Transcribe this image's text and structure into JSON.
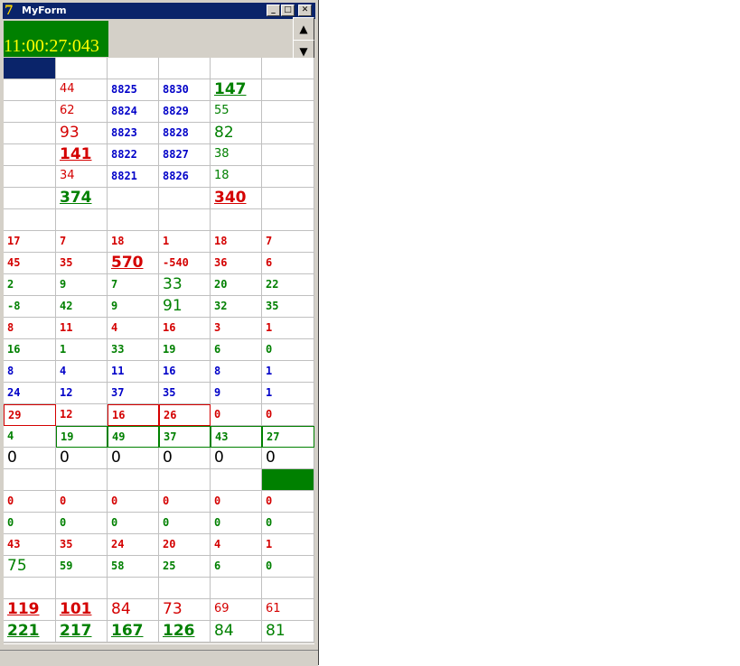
{
  "window": {
    "title": "MyForm",
    "icon": "delphi-app-icon",
    "minimize_label": "_",
    "maximize_label": "□",
    "close_label": "✕"
  },
  "clock": "11:00:27:043",
  "scroll_up_label": "▲",
  "scroll_down_label": "▼",
  "rows": [
    [
      {
        "t": "",
        "c": "fill-navy"
      },
      {
        "t": ""
      },
      {
        "t": ""
      },
      {
        "t": ""
      },
      {
        "t": ""
      },
      {
        "t": ""
      }
    ],
    [
      {
        "t": ""
      },
      {
        "t": "44",
        "c": "r m"
      },
      {
        "t": "8825",
        "c": "b s"
      },
      {
        "t": "8830",
        "c": "b s"
      },
      {
        "t": "147",
        "c": "g xl"
      },
      {
        "t": ""
      }
    ],
    [
      {
        "t": ""
      },
      {
        "t": "62",
        "c": "r m"
      },
      {
        "t": "8824",
        "c": "b s"
      },
      {
        "t": "8829",
        "c": "b s"
      },
      {
        "t": "55",
        "c": "g m"
      },
      {
        "t": ""
      }
    ],
    [
      {
        "t": ""
      },
      {
        "t": "93",
        "c": "r l"
      },
      {
        "t": "8823",
        "c": "b s"
      },
      {
        "t": "8828",
        "c": "b s"
      },
      {
        "t": "82",
        "c": "g l"
      },
      {
        "t": ""
      }
    ],
    [
      {
        "t": ""
      },
      {
        "t": "141",
        "c": "r xl"
      },
      {
        "t": "8822",
        "c": "b s"
      },
      {
        "t": "8827",
        "c": "b s"
      },
      {
        "t": "38",
        "c": "g m"
      },
      {
        "t": ""
      }
    ],
    [
      {
        "t": ""
      },
      {
        "t": "34",
        "c": "r m"
      },
      {
        "t": "8821",
        "c": "b s"
      },
      {
        "t": "8826",
        "c": "b s"
      },
      {
        "t": "18",
        "c": "g m"
      },
      {
        "t": ""
      }
    ],
    [
      {
        "t": ""
      },
      {
        "t": "374",
        "c": "g xl"
      },
      {
        "t": ""
      },
      {
        "t": ""
      },
      {
        "t": "340",
        "c": "r xl"
      },
      {
        "t": ""
      }
    ],
    [
      {
        "t": ""
      },
      {
        "t": ""
      },
      {
        "t": ""
      },
      {
        "t": ""
      },
      {
        "t": ""
      },
      {
        "t": ""
      }
    ],
    [
      {
        "t": "17",
        "c": "r s"
      },
      {
        "t": "7",
        "c": "r s"
      },
      {
        "t": "18",
        "c": "r s"
      },
      {
        "t": "1",
        "c": "r s"
      },
      {
        "t": "18",
        "c": "r s"
      },
      {
        "t": "7",
        "c": "r s"
      }
    ],
    [
      {
        "t": "45",
        "c": "r s"
      },
      {
        "t": "35",
        "c": "r s"
      },
      {
        "t": "570",
        "c": "r xl"
      },
      {
        "t": "-540",
        "c": "r s"
      },
      {
        "t": "36",
        "c": "r s"
      },
      {
        "t": "6",
        "c": "r s"
      }
    ],
    [
      {
        "t": "2",
        "c": "g s"
      },
      {
        "t": "9",
        "c": "g s"
      },
      {
        "t": "7",
        "c": "g s"
      },
      {
        "t": "33",
        "c": "g l"
      },
      {
        "t": "20",
        "c": "g s"
      },
      {
        "t": "22",
        "c": "g s"
      }
    ],
    [
      {
        "t": "-8",
        "c": "g s"
      },
      {
        "t": "42",
        "c": "g s"
      },
      {
        "t": "9",
        "c": "g s"
      },
      {
        "t": "91",
        "c": "g l"
      },
      {
        "t": "32",
        "c": "g s"
      },
      {
        "t": "35",
        "c": "g s"
      }
    ],
    [
      {
        "t": "8",
        "c": "r s"
      },
      {
        "t": "11",
        "c": "r s"
      },
      {
        "t": "4",
        "c": "r s"
      },
      {
        "t": "16",
        "c": "r s"
      },
      {
        "t": "3",
        "c": "r s"
      },
      {
        "t": "1",
        "c": "r s"
      }
    ],
    [
      {
        "t": "16",
        "c": "g s"
      },
      {
        "t": "1",
        "c": "g s"
      },
      {
        "t": "33",
        "c": "g s"
      },
      {
        "t": "19",
        "c": "g s"
      },
      {
        "t": "6",
        "c": "g s"
      },
      {
        "t": "0",
        "c": "g s"
      }
    ],
    [
      {
        "t": "8",
        "c": "b s"
      },
      {
        "t": "4",
        "c": "b s"
      },
      {
        "t": "11",
        "c": "b s"
      },
      {
        "t": "16",
        "c": "b s"
      },
      {
        "t": "8",
        "c": "b s"
      },
      {
        "t": "1",
        "c": "b s"
      }
    ],
    [
      {
        "t": "24",
        "c": "b s"
      },
      {
        "t": "12",
        "c": "b s"
      },
      {
        "t": "37",
        "c": "b s"
      },
      {
        "t": "35",
        "c": "b s"
      },
      {
        "t": "9",
        "c": "b s"
      },
      {
        "t": "1",
        "c": "b s"
      }
    ],
    [
      {
        "t": "29",
        "c": "r s box-r"
      },
      {
        "t": "12",
        "c": "r s"
      },
      {
        "t": "16",
        "c": "r s box-r"
      },
      {
        "t": "26",
        "c": "r s box-r"
      },
      {
        "t": "0",
        "c": "r s"
      },
      {
        "t": "0",
        "c": "r s"
      }
    ],
    [
      {
        "t": "4",
        "c": "g s"
      },
      {
        "t": "19",
        "c": "g s box-g"
      },
      {
        "t": "49",
        "c": "g s box-g"
      },
      {
        "t": "37",
        "c": "g s box-g"
      },
      {
        "t": "43",
        "c": "g s box-g"
      },
      {
        "t": "27",
        "c": "g s box-g"
      }
    ],
    [
      {
        "t": "0",
        "c": "k l"
      },
      {
        "t": "0",
        "c": "k l"
      },
      {
        "t": "0",
        "c": "k l"
      },
      {
        "t": "0",
        "c": "k l"
      },
      {
        "t": "0",
        "c": "k l"
      },
      {
        "t": "0",
        "c": "k l"
      }
    ],
    [
      {
        "t": ""
      },
      {
        "t": ""
      },
      {
        "t": ""
      },
      {
        "t": ""
      },
      {
        "t": ""
      },
      {
        "t": "",
        "c": "fill-green"
      }
    ],
    [
      {
        "t": "0",
        "c": "r s"
      },
      {
        "t": "0",
        "c": "r s"
      },
      {
        "t": "0",
        "c": "r s"
      },
      {
        "t": "0",
        "c": "r s"
      },
      {
        "t": "0",
        "c": "r s"
      },
      {
        "t": "0",
        "c": "r s"
      }
    ],
    [
      {
        "t": "0",
        "c": "g s"
      },
      {
        "t": "0",
        "c": "g s"
      },
      {
        "t": "0",
        "c": "g s"
      },
      {
        "t": "0",
        "c": "g s"
      },
      {
        "t": "0",
        "c": "g s"
      },
      {
        "t": "0",
        "c": "g s"
      }
    ],
    [
      {
        "t": "43",
        "c": "r s"
      },
      {
        "t": "35",
        "c": "r s"
      },
      {
        "t": "24",
        "c": "r s"
      },
      {
        "t": "20",
        "c": "r s"
      },
      {
        "t": "4",
        "c": "r s"
      },
      {
        "t": "1",
        "c": "r s"
      }
    ],
    [
      {
        "t": "75",
        "c": "g l"
      },
      {
        "t": "59",
        "c": "g s"
      },
      {
        "t": "58",
        "c": "g s"
      },
      {
        "t": "25",
        "c": "g s"
      },
      {
        "t": "6",
        "c": "g s"
      },
      {
        "t": "0",
        "c": "g s"
      }
    ],
    [
      {
        "t": ""
      },
      {
        "t": ""
      },
      {
        "t": ""
      },
      {
        "t": ""
      },
      {
        "t": ""
      },
      {
        "t": ""
      }
    ],
    [
      {
        "t": "119",
        "c": "r xl"
      },
      {
        "t": "101",
        "c": "r xl"
      },
      {
        "t": "84",
        "c": "r l"
      },
      {
        "t": "73",
        "c": "r l"
      },
      {
        "t": "69",
        "c": "r m"
      },
      {
        "t": "61",
        "c": "r m"
      }
    ],
    [
      {
        "t": "221",
        "c": "g xl"
      },
      {
        "t": "217",
        "c": "g xl"
      },
      {
        "t": "167",
        "c": "g xl"
      },
      {
        "t": "126",
        "c": "g xl"
      },
      {
        "t": "84",
        "c": "g l"
      },
      {
        "t": "81",
        "c": "g l"
      }
    ]
  ]
}
